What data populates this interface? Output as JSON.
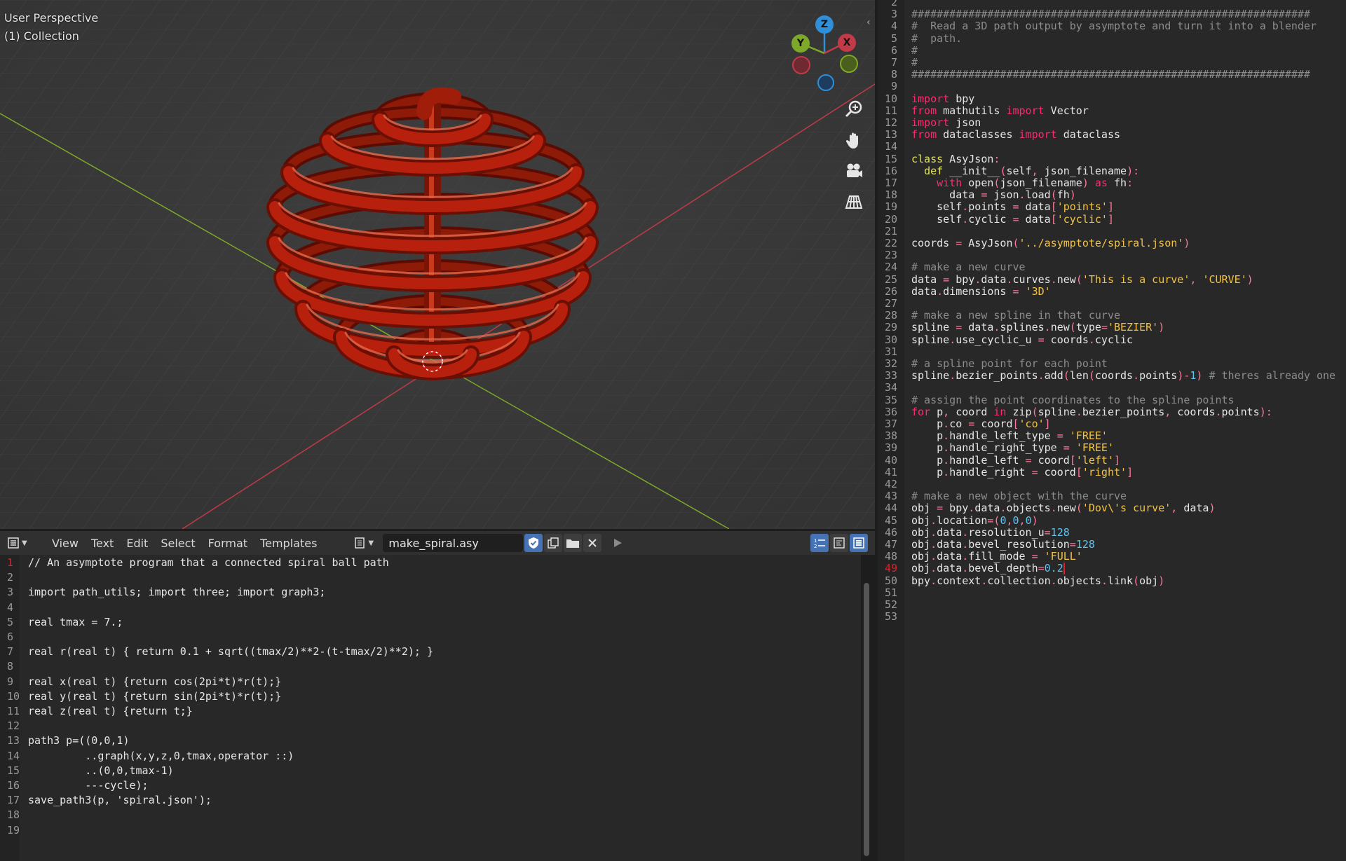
{
  "viewport": {
    "view_label": "User Perspective",
    "collection_label": "(1) Collection",
    "gizmo": {
      "z": "Z",
      "y": "Y",
      "x": "X"
    },
    "tools": [
      "zoom-icon",
      "hand-icon",
      "camera-icon",
      "grid-icon"
    ]
  },
  "bottom_editor": {
    "menus": [
      "View",
      "Text",
      "Edit",
      "Select",
      "Format",
      "Templates"
    ],
    "filename": "make_spiral.asy",
    "current_line": 1,
    "lines": [
      "// An asymptote program that a connected spiral ball path",
      "",
      "import path_utils; import three; import graph3;",
      "",
      "real tmax = 7.;",
      "",
      "real r(real t) { return 0.1 + sqrt((tmax/2)**2-(t-tmax/2)**2); }",
      "",
      "real x(real t) {return cos(2pi*t)*r(t);}",
      "real y(real t) {return sin(2pi*t)*r(t);}",
      "real z(real t) {return t;}",
      "",
      "path3 p=((0,0,1)",
      "         ..graph(x,y,z,0,tmax,operator ::)",
      "         ..(0,0,tmax-1)",
      "         ---cycle);",
      "save_path3(p, 'spiral.json');",
      "",
      ""
    ]
  },
  "right_editor": {
    "first_line_number": 2,
    "current_line": 49,
    "lines": [
      "",
      "###############################################################",
      "#  Read a 3D path output by asymptote and turn it into a blender",
      "#  path.",
      "#",
      "#",
      "###############################################################",
      "",
      "import bpy",
      "from mathutils import Vector",
      "import json",
      "from dataclasses import dataclass",
      "",
      "class AsyJson:",
      "  def __init__(self, json_filename):",
      "    with open(json_filename) as fh:",
      "      data = json.load(fh)",
      "    self.points = data['points']",
      "    self.cyclic = data['cyclic']",
      "",
      "coords = AsyJson('../asymptote/spiral.json')",
      "",
      "# make a new curve",
      "data = bpy.data.curves.new('This is a curve', 'CURVE')",
      "data.dimensions = '3D'",
      "",
      "# make a new spline in that curve",
      "spline = data.splines.new(type='BEZIER')",
      "spline.use_cyclic_u = coords.cyclic",
      "",
      "# a spline point for each point",
      "spline.bezier_points.add(len(coords.points)-1) # theres already one",
      "",
      "# assign the point coordinates to the spline points",
      "for p, coord in zip(spline.bezier_points, coords.points):",
      "    p.co = coord['co']",
      "    p.handle_left_type = 'FREE'",
      "    p.handle_right_type = 'FREE'",
      "    p.handle_left = coord['left']",
      "    p.handle_right = coord['right']",
      "",
      "# make a new object with the curve",
      "obj = bpy.data.objects.new('Dov\\'s curve', data)",
      "obj.location=(0,0,0)",
      "obj.data.resolution_u=128",
      "obj.data.bevel_resolution=128",
      "obj.data.fill_mode = 'FULL'",
      "obj.data.bevel_depth=0.2",
      "bpy.context.collection.objects.link(obj)",
      "",
      "",
      ""
    ]
  },
  "colors": {
    "keyword": "#ff2a6d",
    "definition": "#e2e25a",
    "string": "#f2c344",
    "comment": "#8c8c8c",
    "number": "#5ec4f0",
    "spiral": "#b8200e",
    "axis_x": "#c23a48",
    "axis_y": "#7ea82a",
    "axis_z": "#2f8fd8"
  }
}
